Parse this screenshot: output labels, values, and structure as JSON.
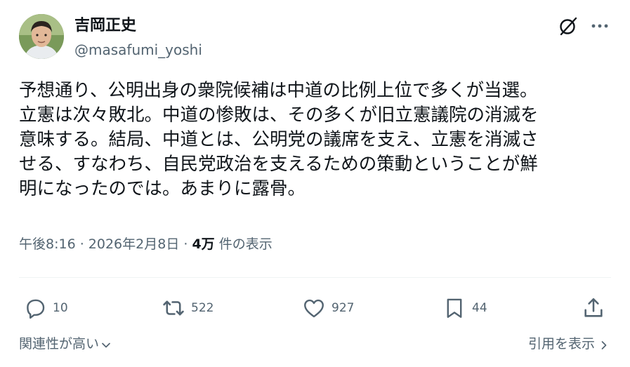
{
  "author": {
    "display_name": "吉岡正史",
    "handle": "@masafumi_yoshi"
  },
  "post": {
    "text": "予想通り、公明出身の衆院候補は中道の比例上位で多くが当選。\n立憲は次々敗北。中道の惨敗は、その多くが旧立憲議院の消滅を\n意味する。結局、中道とは、公明党の議席を支え、立憲を消滅さ\nせる、すなわち、自民党政治を支えるための策動ということが鮮\n明になったのでは。あまりに露骨。",
    "timestamp": "午後8:16 · 2026年2月8日 · ",
    "views_count": "4万",
    "views_label": " 件の表示"
  },
  "actions": {
    "replies": "10",
    "reposts": "522",
    "likes": "927",
    "bookmarks": "44"
  },
  "footer": {
    "sort_label": "関連性が高い",
    "quotes_label": "引用を表示"
  },
  "icons": {
    "avatar": "avatar",
    "grok": "grok-icon",
    "more": "more-icon",
    "reply": "reply-icon",
    "repost": "repost-icon",
    "like": "like-icon",
    "bookmark": "bookmark-icon",
    "share": "share-icon",
    "chevron_down": "chevron-down-icon",
    "chevron_right": "chevron-right-icon"
  },
  "colors": {
    "text_primary": "#0f1419",
    "text_secondary": "#536471",
    "divider": "#eff3f4"
  }
}
